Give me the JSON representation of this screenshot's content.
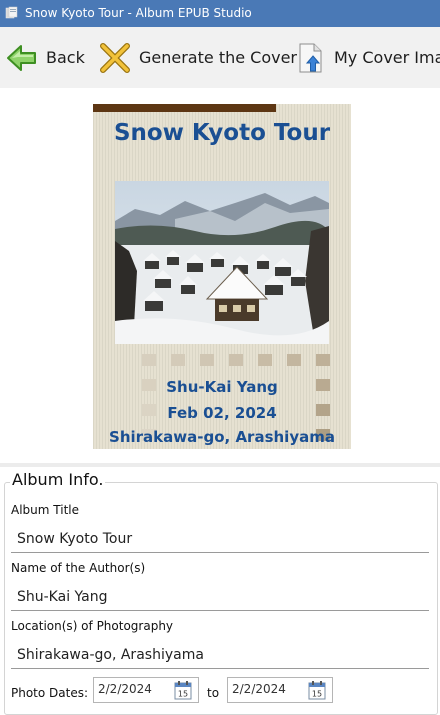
{
  "window": {
    "title": "Snow Kyoto Tour - Album EPUB Studio"
  },
  "toolbar": {
    "back_label": "Back",
    "generate_label": "Generate the Cover",
    "my_cover_label": "My Cover Image"
  },
  "cover": {
    "title": "Snow Kyoto Tour",
    "author": "Shu-Kai Yang",
    "date": "Feb 02, 2024",
    "location": "Shirakawa-go, Arashiyama",
    "colors": {
      "bar": "#5d3613",
      "title": "#1a4f93",
      "background": "#e6e1d1",
      "squares": "#c2b6a1"
    }
  },
  "album_info": {
    "legend": "Album Info.",
    "title_label": "Album Title",
    "title_value": "Snow Kyoto Tour",
    "author_label": "Name of the Author(s)",
    "author_value": "Shu-Kai Yang",
    "location_label": "Location(s) of Photography",
    "location_value": "Shirakawa-go, Arashiyama",
    "dates_label": "Photo Dates:",
    "date_from": "2/2/2024",
    "date_to_label": "to",
    "date_to": "2/2/2024",
    "calendar_day": "15"
  }
}
